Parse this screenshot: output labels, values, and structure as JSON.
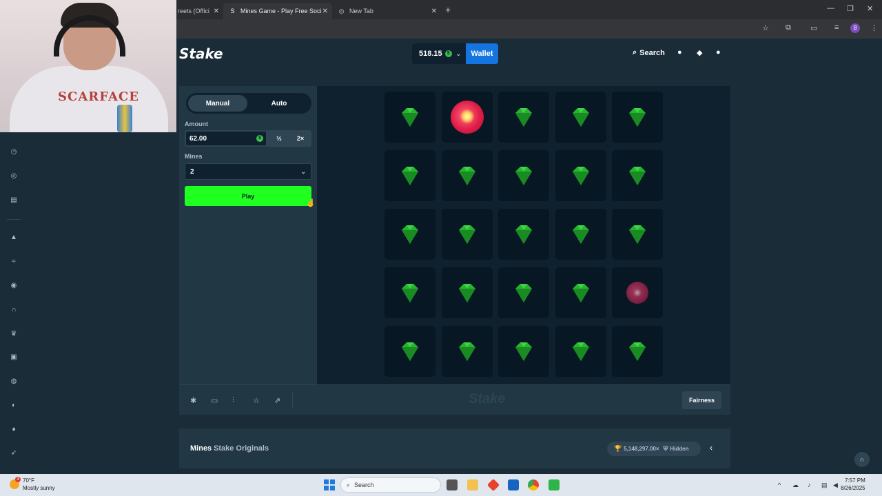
{
  "browser": {
    "tabs": [
      {
        "title": "reets (Offici",
        "active": false
      },
      {
        "title": "Mines Game - Play Free Social",
        "active": true
      },
      {
        "title": "New Tab",
        "active": false
      }
    ],
    "close_glyph": "✕",
    "new_tab_glyph": "+",
    "profile_initial": "B"
  },
  "header": {
    "logo": "Stake",
    "balance": "518.15",
    "currency_symbol": "$",
    "wallet_label": "Wallet",
    "search_label": "Search"
  },
  "bet_panel": {
    "tabs": {
      "manual": "Manual",
      "auto": "Auto"
    },
    "active_tab": "Manual",
    "amount_label": "Amount",
    "amount_value": "62.00",
    "half_label": "½",
    "double_label": "2×",
    "mines_label": "Mines",
    "mines_value": "2",
    "play_label": "Play"
  },
  "board": {
    "rows": 5,
    "cols": 5,
    "tiles": [
      "gem",
      "bomb-hit",
      "gem",
      "gem",
      "gem",
      "gem",
      "gem",
      "gem",
      "gem",
      "gem",
      "gem",
      "gem",
      "gem",
      "gem",
      "gem",
      "gem",
      "gem",
      "gem",
      "gem",
      "bomb",
      "gem",
      "gem",
      "gem",
      "gem",
      "gem"
    ]
  },
  "footer": {
    "watermark": "Stake",
    "fairness_label": "Fairness"
  },
  "info_bar": {
    "game_name": "Mines",
    "provider": "Stake Originals",
    "max_win": "5,148,297.00×",
    "hidden_label": "Hidden"
  },
  "taskbar": {
    "weather_badge": "3",
    "weather_temp": "70°F",
    "weather_desc": "Mostly sunny",
    "search_placeholder": "Search",
    "time": "7:57 PM",
    "date": "8/26/2025"
  },
  "webcam_overlay": {
    "shirt_text": "SCARFACE"
  },
  "colors": {
    "gem": "#27b52f",
    "gem_dark": "#1a8a22",
    "play_button": "#1fff20",
    "wallet_button": "#1475e1",
    "bomb": "#e11d48"
  }
}
